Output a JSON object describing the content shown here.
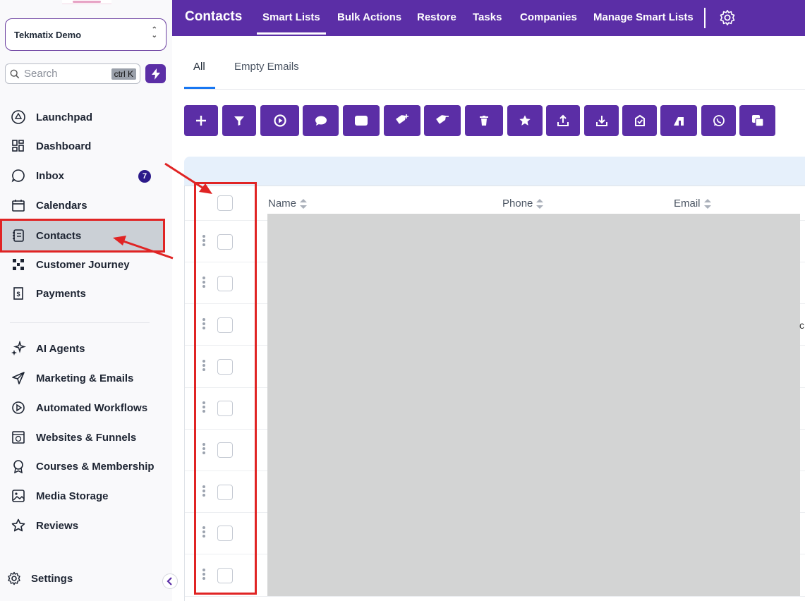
{
  "sidebar": {
    "account_name": "Tekmatix Demo",
    "search_placeholder": "Search",
    "search_shortcut": "ctrl K",
    "items": [
      {
        "label": "Launchpad",
        "icon": "launchpad-icon"
      },
      {
        "label": "Dashboard",
        "icon": "dashboard-icon"
      },
      {
        "label": "Inbox",
        "icon": "chat-bubble-icon",
        "badge": "7"
      },
      {
        "label": "Calendars",
        "icon": "calendar-icon"
      },
      {
        "label": "Contacts",
        "icon": "contacts-book-icon",
        "active": true
      },
      {
        "label": "Customer Journey",
        "icon": "journey-icon"
      },
      {
        "label": "Payments",
        "icon": "invoice-icon"
      },
      {
        "label": "AI Agents",
        "icon": "sparkle-icon"
      },
      {
        "label": "Marketing & Emails",
        "icon": "send-icon"
      },
      {
        "label": "Automated Workflows",
        "icon": "play-circle-icon"
      },
      {
        "label": "Websites & Funnels",
        "icon": "globe-window-icon"
      },
      {
        "label": "Courses & Membership",
        "icon": "award-icon"
      },
      {
        "label": "Media Storage",
        "icon": "image-icon"
      },
      {
        "label": "Reviews",
        "icon": "star-outline-icon"
      }
    ],
    "settings_label": "Settings"
  },
  "topbar": {
    "title": "Contacts",
    "nav": [
      "Smart Lists",
      "Bulk Actions",
      "Restore",
      "Tasks",
      "Companies",
      "Manage Smart Lists"
    ],
    "active_nav": "Smart Lists"
  },
  "subtabs": {
    "all": "All",
    "empty_emails": "Empty Emails",
    "active": "All"
  },
  "toolbar": {
    "buttons": [
      "add-icon",
      "filter-icon",
      "workflow-icon",
      "sms-icon",
      "email-icon",
      "add-tag-icon",
      "remove-tag-icon",
      "delete-icon",
      "star-icon",
      "export-icon",
      "import-icon",
      "review-request-icon",
      "merge-icon",
      "whatsapp-icon",
      "duplicate-icon"
    ]
  },
  "table": {
    "columns": [
      "Name",
      "Phone",
      "Email"
    ],
    "row_count_visible": 9,
    "content_redacted": true
  },
  "colors": {
    "brand": "#5b2ea6",
    "annotation": "#e02424",
    "badge": "#2c1a8a",
    "active_tab_underline": "#1877f2"
  }
}
